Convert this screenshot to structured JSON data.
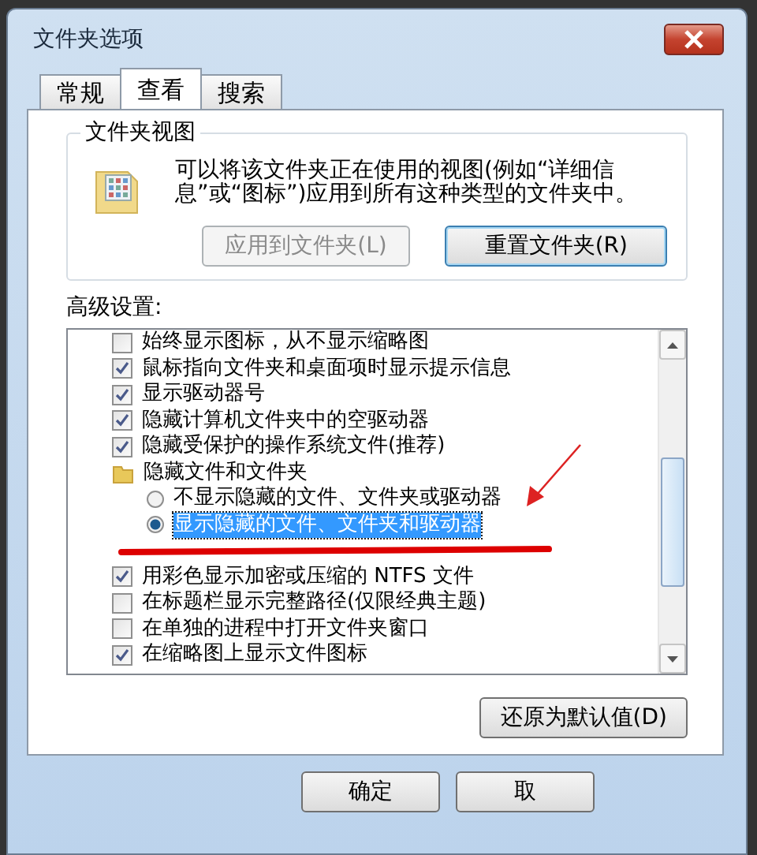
{
  "window": {
    "title": "文件夹选项"
  },
  "tabs": [
    {
      "label": "常规",
      "selected": false
    },
    {
      "label": "查看",
      "selected": true
    },
    {
      "label": "搜索",
      "selected": false
    }
  ],
  "folder_views": {
    "title": "文件夹视图",
    "description": "可以将该文件夹正在使用的视图(例如“详细信息”或“图标”)应用到所有这种类型的文件夹中。",
    "buttons": [
      {
        "label": "应用到文件夹(L)",
        "disabled": true
      },
      {
        "label": "重置文件夹(R)",
        "disabled": false
      }
    ]
  },
  "advanced": {
    "label": "高级设置:",
    "items": [
      {
        "kind": "checkbox",
        "label": "始终显示图标，从不显示缩略图",
        "checked": false
      },
      {
        "kind": "checkbox",
        "label": "鼠标指向文件夹和桌面项时显示提示信息",
        "checked": true
      },
      {
        "kind": "checkbox",
        "label": "显示驱动器号",
        "checked": true
      },
      {
        "kind": "checkbox",
        "label": "隐藏计算机文件夹中的空驱动器",
        "checked": true
      },
      {
        "kind": "checkbox",
        "label": "隐藏受保护的操作系统文件(推荐)",
        "checked": true
      },
      {
        "kind": "folder",
        "label": "隐藏文件和文件夹",
        "children": [
          {
            "kind": "radio",
            "label": "不显示隐藏的文件、文件夹或驱动器",
            "selected": false
          },
          {
            "kind": "radio",
            "label": "显示隐藏的文件、文件夹和驱动器",
            "selected": true
          }
        ]
      },
      {
        "kind": "checkbox",
        "label": "用彩色显示加密或压缩的 NTFS 文件",
        "checked": true
      },
      {
        "kind": "checkbox",
        "label": "在标题栏显示完整路径(仅限经典主题)",
        "checked": false
      },
      {
        "kind": "checkbox",
        "label": "在单独的进程中打开文件夹窗口",
        "checked": false
      },
      {
        "kind": "checkbox",
        "label": "在缩略图上显示文件图标",
        "checked": true
      }
    ]
  },
  "restore_button": "还原为默认值(D)",
  "buttons": [
    "确定",
    "取"
  ]
}
